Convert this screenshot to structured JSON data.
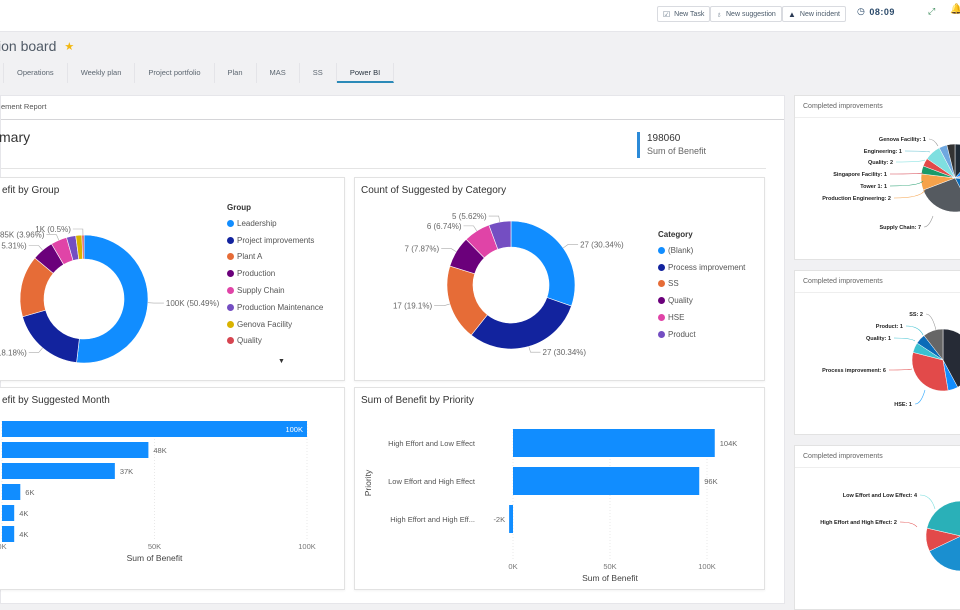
{
  "topbar": {
    "buttons": [
      {
        "label": "New Task",
        "icon": "checkbox-icon"
      },
      {
        "label": "New suggestion",
        "icon": "lightbulb-icon"
      },
      {
        "label": "New incident",
        "icon": "warning-icon"
      }
    ],
    "clock": "08:09"
  },
  "page": {
    "title": "ion board"
  },
  "tabs": [
    {
      "label": "Operations"
    },
    {
      "label": "Weekly plan"
    },
    {
      "label": "Project portfolio"
    },
    {
      "label": "Plan"
    },
    {
      "label": "MAS"
    },
    {
      "label": "SS"
    },
    {
      "label": "Power BI",
      "active": true
    }
  ],
  "report": {
    "header": "ement Report",
    "summary_title": "mary",
    "kpi": {
      "value": "198060",
      "label": "Sum of Benefit"
    }
  },
  "colors": {
    "blue": "#118DFF",
    "navy": "#12239E",
    "orange": "#E66C37",
    "purple": "#6B007B",
    "pink": "#E044A7",
    "violet": "#744EC2",
    "gold": "#D9B300",
    "red": "#D64550"
  },
  "chart_data": [
    {
      "id": "benefit-by-group",
      "type": "pie",
      "title": "efit by Group",
      "legend_title": "Group",
      "legend": [
        "Leadership",
        "Project improvements",
        "Plant A",
        "Production",
        "Supply Chain",
        "Production Maintenance",
        "Genova Facility",
        "Quality"
      ],
      "slices": [
        {
          "name": "Leadership",
          "value": 100000,
          "pct": 50.49,
          "label": "100K (50.49%)"
        },
        {
          "name": "Project improvements",
          "value": 36000,
          "pct": 18.18,
          "label": "(18.18%)"
        },
        {
          "name": "Plant A",
          "value": 30000,
          "pct": 15.2,
          "label": ""
        },
        {
          "name": "Production",
          "value": 10500,
          "pct": 5.31,
          "label": "5.31%)"
        },
        {
          "name": "Supply Chain",
          "value": 7850,
          "pct": 3.96,
          "label": "85K (3.96%)"
        },
        {
          "name": "Production Maintenance",
          "value": 4500,
          "pct": 2.3,
          "label": ""
        },
        {
          "name": "Genova Facility",
          "value": 3000,
          "pct": 1.5,
          "label": ""
        },
        {
          "name": "Quality",
          "value": 1000,
          "pct": 0.5,
          "label": "1K (0.5%)"
        }
      ]
    },
    {
      "id": "count-by-category",
      "type": "pie",
      "title": "Count of Suggested by Category",
      "legend_title": "Category",
      "legend": [
        "(Blank)",
        "Process improvement",
        "SS",
        "Quality",
        "HSE",
        "Product"
      ],
      "slices": [
        {
          "name": "(Blank)",
          "value": 27,
          "pct": 30.34,
          "label": "27 (30.34%)"
        },
        {
          "name": "Process improvement",
          "value": 27,
          "pct": 30.34,
          "label": "27 (30.34%)"
        },
        {
          "name": "SS",
          "value": 17,
          "pct": 19.1,
          "label": "17 (19.1%)"
        },
        {
          "name": "Quality",
          "value": 7,
          "pct": 7.87,
          "label": "7 (7.87%)"
        },
        {
          "name": "HSE",
          "value": 6,
          "pct": 6.74,
          "label": "6 (6.74%)"
        },
        {
          "name": "Product",
          "value": 5,
          "pct": 5.62,
          "label": "5 (5.62%)"
        }
      ]
    },
    {
      "id": "benefit-by-month",
      "type": "bar",
      "title": "efit by Suggested Month",
      "xlabel": "Sum of Benefit",
      "xlim": [
        0,
        100000
      ],
      "ticks": [
        "0K",
        "50K",
        "100K"
      ],
      "values": [
        100000,
        48000,
        37000,
        6000,
        4000,
        4000
      ],
      "labels": [
        "100K",
        "48K",
        "37K",
        "6K",
        "4K",
        "4K"
      ]
    },
    {
      "id": "benefit-by-priority",
      "type": "bar",
      "title": "Sum of Benefit by Priority",
      "xlabel": "Sum of Benefit",
      "ylabel": "Priority",
      "xlim": [
        0,
        100000
      ],
      "ticks": [
        "0K",
        "50K",
        "100K"
      ],
      "categories": [
        "High Effort and Low Effect",
        "Low Effort and High Effect",
        "High Effort and High Eff..."
      ],
      "values": [
        104000,
        96000,
        -2000
      ],
      "labels": [
        "104K",
        "96K",
        "-2K"
      ]
    },
    {
      "id": "completed-by-group",
      "type": "pie",
      "title": "Completed improvements",
      "labels": [
        "Genova Facility: 1",
        "Engineering: 1",
        "Quality: 2",
        "Singapore Facility: 1",
        "Tower 1: 1",
        "Production Engineering: 2",
        "Supply Chain: 7"
      ]
    },
    {
      "id": "completed-by-category",
      "type": "pie",
      "title": "Completed improvements",
      "labels": [
        "SS: 2",
        "Product: 1",
        "Quality: 1",
        "Process improvement: 6",
        "HSE: 1"
      ]
    },
    {
      "id": "completed-by-priority",
      "type": "pie",
      "title": "Completed improvements",
      "labels": [
        "Low Effort and Low Effect: 4",
        "High Effort and High Effect: 2"
      ]
    }
  ]
}
